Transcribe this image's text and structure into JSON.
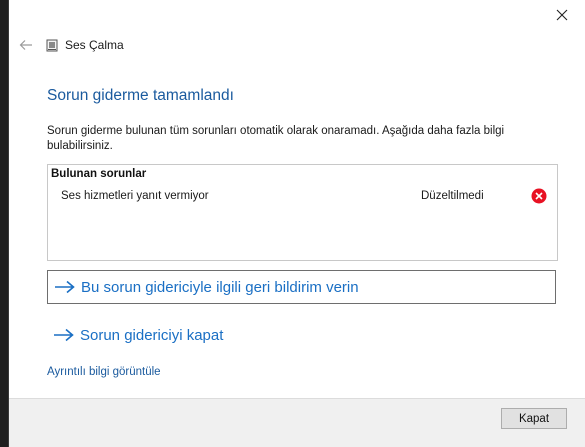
{
  "window": {
    "app_title": "Ses Çalma"
  },
  "main": {
    "heading": "Sorun giderme tamamlandı",
    "description": "Sorun giderme bulunan tüm sorunları otomatik olarak onaramadı. Aşağıda daha fazla bilgi bulabilirsiniz."
  },
  "problems": {
    "header": "Bulunan sorunlar",
    "items": [
      {
        "name": "Ses hizmetleri yanıt vermiyor",
        "status": "Düzeltilmedi",
        "status_icon": "error-x-icon",
        "status_color": "#e81123"
      }
    ]
  },
  "links": {
    "feedback": "Bu sorun gidericiyle ilgili geri bildirim verin",
    "close_troubleshooter": "Sorun gidericiyi kapat",
    "details": "Ayrıntılı bilgi görüntüle"
  },
  "footer": {
    "close_button": "Kapat"
  },
  "colors": {
    "heading": "#1a5a9e",
    "link": "#1a6fc4",
    "error": "#e81123"
  }
}
